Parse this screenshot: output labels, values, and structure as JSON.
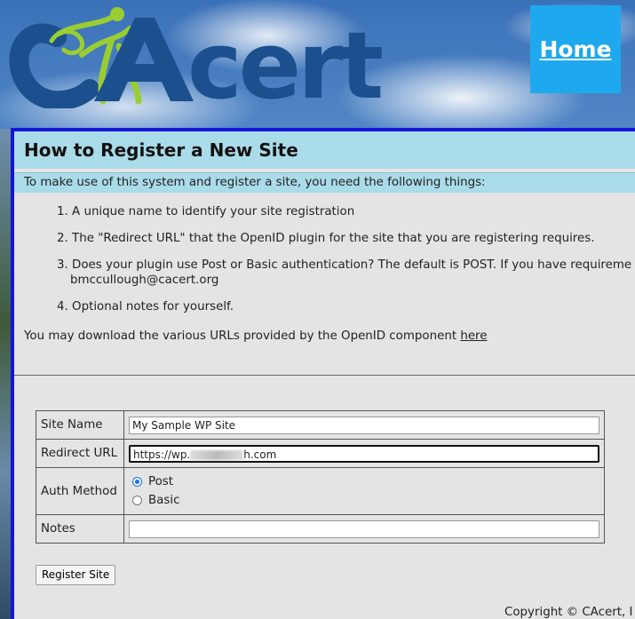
{
  "header": {
    "logo_text": "CAcert",
    "home_link": "Home"
  },
  "panel": {
    "title": "How to Register a New Site",
    "intro": "To make use of this system and register a site, you need the following things:",
    "steps": [
      {
        "num": "1.",
        "text": "A unique name to identify your site registration"
      },
      {
        "num": "2.",
        "text": "The \"Redirect URL\" that the OpenID plugin for the site that you are registering requires."
      },
      {
        "num": "3.",
        "text": "Does your plugin use Post or Basic authentication? The default is POST. If you have requireme",
        "cont": "bmccullough@cacert.org"
      },
      {
        "num": "4.",
        "text": "Optional notes for yourself."
      }
    ],
    "download_text": "You may download the various URLs provided by the OpenID component ",
    "download_link": "here"
  },
  "form": {
    "site_name_label": "Site Name",
    "site_name_value": "My Sample WP Site",
    "redirect_label": "Redirect URL",
    "redirect_prefix": "https://wp.",
    "redirect_suffix": "h.com",
    "auth_label": "Auth Method",
    "auth_options": [
      {
        "label": "Post",
        "selected": true
      },
      {
        "label": "Basic",
        "selected": false
      }
    ],
    "notes_label": "Notes",
    "notes_value": "",
    "submit_label": "Register Site"
  },
  "footer": {
    "copyright": "Copyright © CAcert, I"
  },
  "colors": {
    "accent_border": "#1515d8",
    "title_bg": "#aadbe8",
    "home_bg": "#1ea9ee",
    "logo_blue": "#1b4f8e",
    "logo_green": "#9acd32"
  }
}
